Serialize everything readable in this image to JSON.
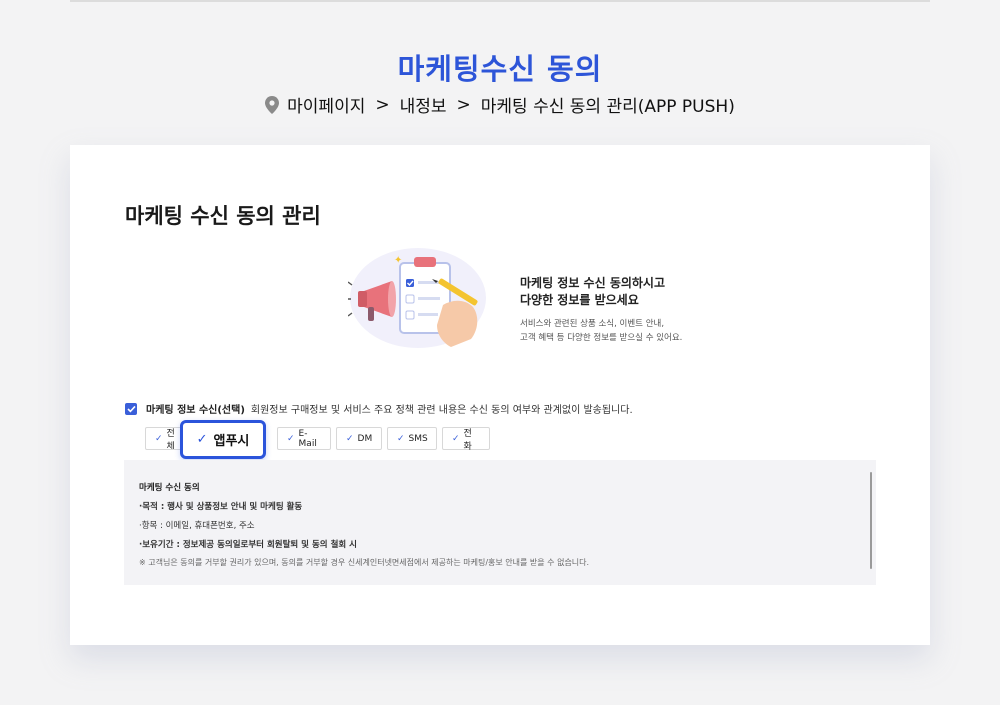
{
  "page": {
    "title": "마케팅수신  동의",
    "breadcrumb": [
      "마이페이지",
      "내정보",
      "마케팅 수신 동의 관리(APP PUSH)"
    ],
    "breadcrumb_sep": ">"
  },
  "card": {
    "title": "마케팅 수신 동의 관리",
    "promo": {
      "head_line1": "마케팅 정보 수신 동의하시고",
      "head_line2": "다양한 정보를 받으세요",
      "sub_line1": "서비스와 관련된 상품 소식, 이벤트 안내,",
      "sub_line2": "고객 혜택 등 다양한 정보를 받으실 수 있어요."
    },
    "consent": {
      "checked": true,
      "label": "마케팅 정보 수신(선택)",
      "description": "회원정보 구매정보 및 서비스 주요 정책 관련 내용은 수신 동의 여부와 관계없이 발송됩니다."
    },
    "channels": {
      "all": "전체",
      "push": "앱푸시",
      "email": "E-Mail",
      "dm": "DM",
      "sms": "SMS",
      "tel": "전화"
    },
    "terms": {
      "title": "마케팅 수신 동의",
      "purpose": "·목적 : 행사 및 상품정보 안내 및 마케팅 활동",
      "items": "·항목 : 이메일, 휴대폰번호, 주소",
      "period": "·보유기간 : 정보제공 동의일로부터 회원탈퇴 및 동의 철회 시",
      "note": "※ 고객님은 동의를 거부할 권리가 있으며, 동의를 거부할 경우 신세계인터넷면세점에서 제공하는 마케팅/홍보 안내를 받을 수 없습니다."
    }
  },
  "colors": {
    "accent": "#2d55d8",
    "checkbox": "#3a5fd9",
    "background": "#f3f3f4",
    "terms_bg": "#f3f3f6"
  },
  "icons": [
    "location-pin-icon",
    "checkbox-checked-icon",
    "check-icon",
    "megaphone-clipboard-illustration"
  ]
}
